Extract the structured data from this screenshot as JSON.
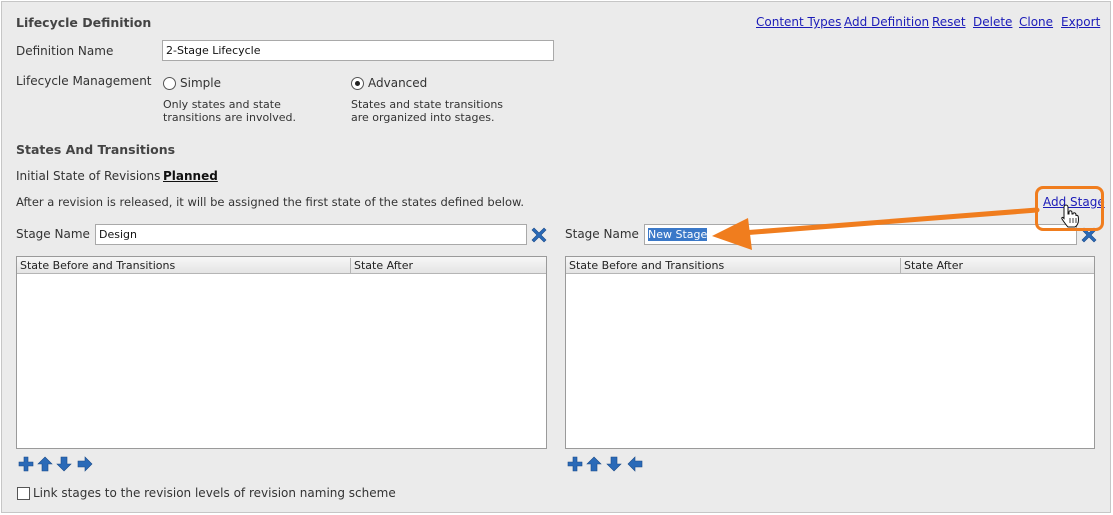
{
  "header": {
    "title": "Lifecycle Definition",
    "actions": [
      "Content Types",
      "Add Definition",
      "Reset",
      "Delete",
      "Clone",
      "Export"
    ]
  },
  "definition": {
    "name_label": "Definition Name",
    "name_value": "2-Stage Lifecycle"
  },
  "management": {
    "label": "Lifecycle Management",
    "simple": {
      "label": "Simple",
      "description": "Only states and state transitions are involved.",
      "checked": false
    },
    "advanced": {
      "label": "Advanced",
      "description": "States and state transitions are organized into stages.",
      "checked": true
    }
  },
  "states": {
    "title": "States And Transitions",
    "initial_label": "Initial State of Revisions",
    "initial_value": "Planned",
    "info": "After a revision is released, it will be assigned the first state of the states defined below.",
    "add_stage": "Add Stage"
  },
  "stages": [
    {
      "name_label": "Stage Name",
      "name_value": "Design",
      "columns": [
        "State Before and Transitions",
        "State After"
      ],
      "toolbar_icons": [
        "add-icon",
        "move-up-icon",
        "move-down-icon",
        "move-right-icon"
      ]
    },
    {
      "name_label": "Stage Name",
      "name_value": "New Stage",
      "columns": [
        "State Before and Transitions",
        "State After"
      ],
      "toolbar_icons": [
        "add-icon",
        "move-up-icon",
        "move-down-icon",
        "move-left-icon"
      ]
    }
  ],
  "footer": {
    "link_label": "Link stages to the revision levels of revision naming scheme",
    "checked": false
  },
  "colors": {
    "accent_orange": "#f07d1e",
    "link_blue": "#1b1bb8",
    "icon_blue": "#2a6ab8",
    "selection": "#3a78c8"
  }
}
